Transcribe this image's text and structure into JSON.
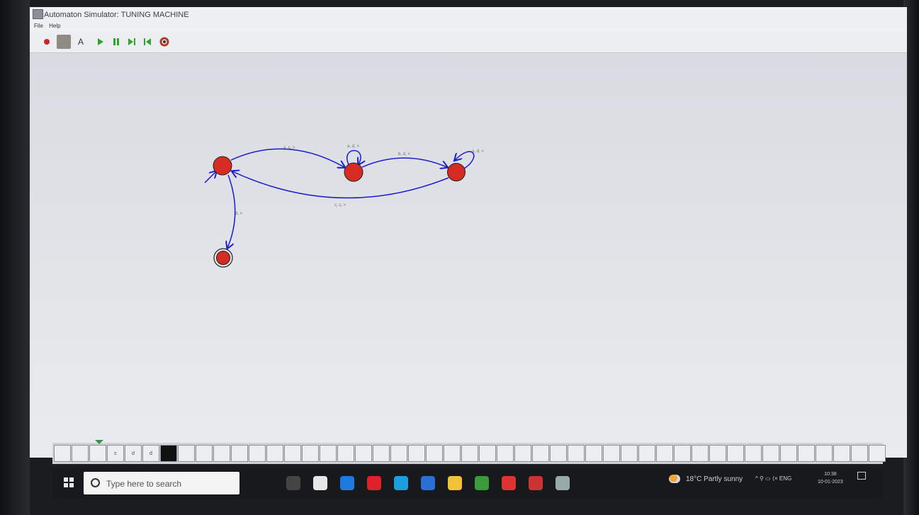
{
  "window": {
    "title": "Automaton Simulator: TUNING MACHINE",
    "maximize_glyph": "▫",
    "close_glyph": "×"
  },
  "menu": {
    "file": "File",
    "help": "Help"
  },
  "toolbar": {
    "text_tool_label": "A"
  },
  "automaton": {
    "states": [
      {
        "id": "q0",
        "initial": true,
        "accepting": false
      },
      {
        "id": "q1",
        "initial": false,
        "accepting": false
      },
      {
        "id": "q2",
        "initial": false,
        "accepting": false
      },
      {
        "id": "q3",
        "initial": false,
        "accepting": true
      }
    ],
    "transitions": [
      {
        "from": "q0",
        "to": "q1",
        "label": "a, c, >"
      },
      {
        "from": "q1",
        "to": "q1",
        "label": "a, d, >"
      },
      {
        "from": "q1",
        "to": "q2",
        "label": "b, d, <"
      },
      {
        "from": "q2",
        "to": "q2",
        "label": "a, d, <"
      },
      {
        "from": "q2",
        "to": "q0",
        "label": "c, c, >"
      },
      {
        "from": "q0",
        "to": "q3",
        "label": "d, >"
      }
    ]
  },
  "tape": {
    "cells": [
      "",
      "",
      "",
      "c",
      "d",
      "d",
      "#"
    ]
  },
  "taskbar": {
    "search_placeholder": "Type here to search",
    "weather": "18°C  Partly sunny",
    "tray": "^  ⚲  ▭  ⟨×  ENG",
    "time": "10:38",
    "date": "10-01-2023",
    "apps": [
      "widgets",
      "explorer",
      "mail",
      "opera",
      "edge",
      "store",
      "files",
      "chrome",
      "acrobat",
      "chrome-alt",
      "java"
    ],
    "app_colors": [
      "#444",
      "#e6e6e6",
      "#1f7ae0",
      "#e0202a",
      "#1b9ede",
      "#2a6fd1",
      "#f0c23a",
      "#3b9b3b",
      "#d33",
      "#c33",
      "#9aa"
    ]
  }
}
